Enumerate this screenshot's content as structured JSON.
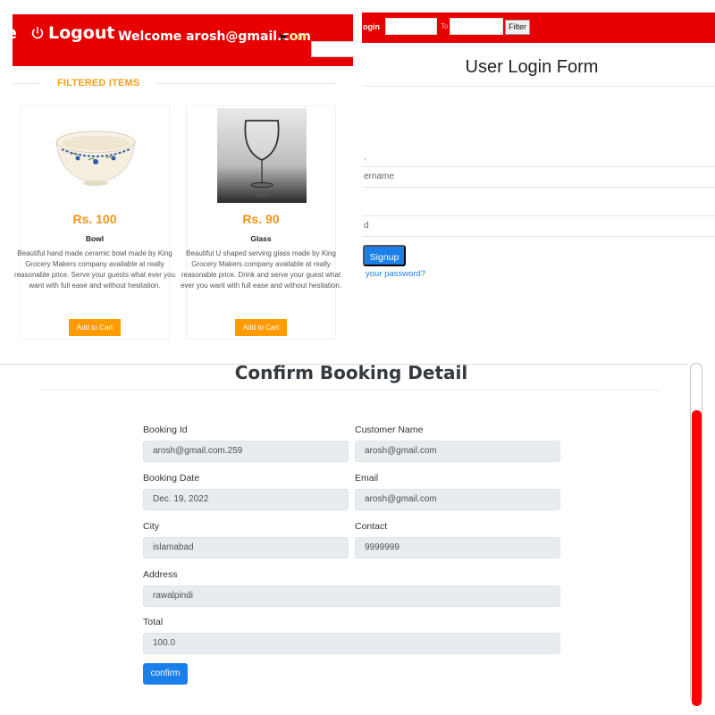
{
  "shop": {
    "nav": {
      "edge_text": "e",
      "logout_label": "Logout",
      "welcome_text": "Welcome arosh@gmail.com",
      "cart_label": "Cart"
    },
    "filtered_title": "FILTERED ITEMS",
    "products": [
      {
        "price": "Rs. 100",
        "name": "Bowl",
        "description": "Beautiful hand made ceramic bowl made by King Grocery Makers company available at really reasonable price. Serve your guests what ever you want with full ease and without hesitation.",
        "button_label": "Add to Cart"
      },
      {
        "price": "Rs. 90",
        "name": "Glass",
        "description": "Beautiful U shaped serving glass made by King Grocery Makers company available at really reasonable price. Drink and serve your guest what ever you want with full ease and without hesitation.",
        "button_label": "Add to Cart"
      }
    ]
  },
  "login": {
    "bar": {
      "left_text": "ogin",
      "to_text": "To",
      "filter_label": "Filter"
    },
    "title": "User Login Form",
    "fragment_text": ",",
    "username_placeholder": "ername",
    "password_placeholder": "d",
    "signup_label": "Signup",
    "forgot_text": "your password?"
  },
  "booking": {
    "title": "Confirm Booking Detail",
    "fields": {
      "booking_id": {
        "label": "Booking Id",
        "value": "arosh@gmail.com.259"
      },
      "customer_name": {
        "label": "Customer Name",
        "value": "arosh@gmail.com"
      },
      "booking_date": {
        "label": "Booking Date",
        "value": "Dec. 19, 2022"
      },
      "email": {
        "label": "Email",
        "value": "arosh@gmail.com"
      },
      "city": {
        "label": "City",
        "value": "islamabad"
      },
      "contact": {
        "label": "Contact",
        "value": "9999999"
      },
      "address": {
        "label": "Address",
        "value": "rawalpindi"
      },
      "total": {
        "label": "Total",
        "value": "100.0"
      }
    },
    "confirm_label": "confirm"
  },
  "colors": {
    "nav_red": "#e60000",
    "accent_orange": "#f39412",
    "button_orange": "#ff9a00",
    "primary_blue": "#1a7fe8",
    "scrollbar_red": "#ff0000"
  },
  "icons": [
    "power-icon",
    "cart-icon"
  ]
}
